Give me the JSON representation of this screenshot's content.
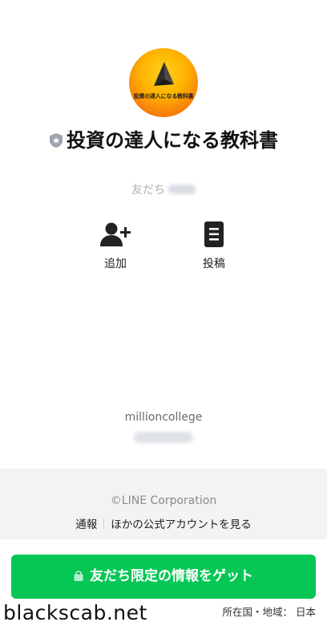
{
  "profile": {
    "avatar_text": "投資の達人になる教科書",
    "title": "投資の達人になる教科書",
    "friends_label": "友だち"
  },
  "actions": [
    {
      "label": "追加",
      "icon": "add-friend-icon"
    },
    {
      "label": "投稿",
      "icon": "document-icon"
    }
  ],
  "account": {
    "handle": "millioncollege"
  },
  "footer": {
    "copyright": "©LINE Corporation",
    "report": "通報",
    "other_accounts": "ほかの公式アカウントを見る"
  },
  "cta": {
    "label": "友だち限定の情報をゲット"
  },
  "region": "所在国・地域： 日本",
  "watermark": "blackscab.net",
  "colors": {
    "cta_green": "#06c755",
    "verified_badge": "#9ea3ad"
  }
}
